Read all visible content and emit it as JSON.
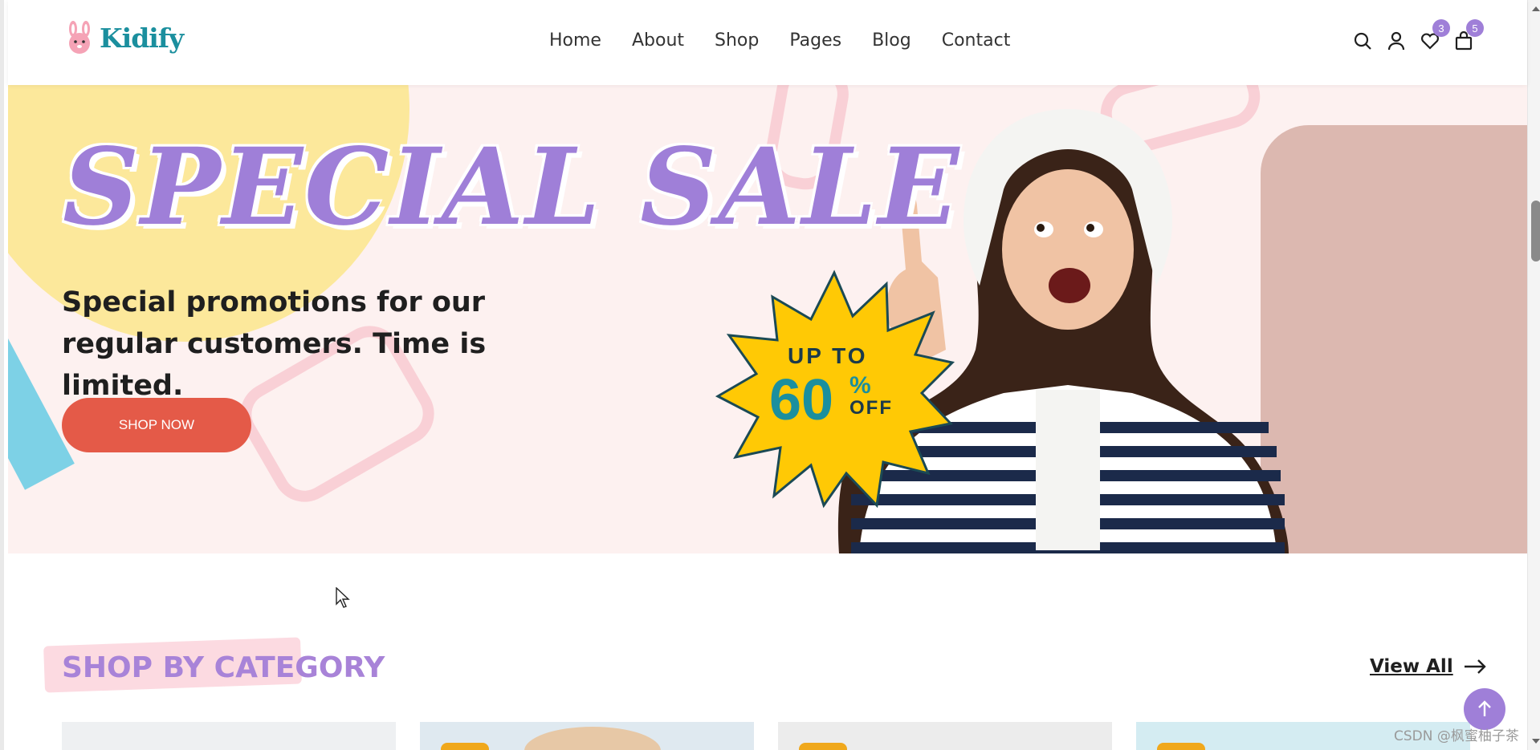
{
  "header": {
    "logo_text": "Kidify",
    "nav": [
      "Home",
      "About",
      "Shop",
      "Pages",
      "Blog",
      "Contact"
    ],
    "wishlist_count": "3",
    "cart_count": "5"
  },
  "hero": {
    "title": "SPECIAL SALE",
    "subtitle": "Special promotions for our regular customers. Time is limited.",
    "cta_label": "SHOP NOW",
    "badge_upto": "UP TO",
    "badge_number": "60",
    "badge_percent": "%",
    "badge_off": "OFF"
  },
  "category": {
    "title": "SHOP BY CATEGORY",
    "view_all": "View All"
  },
  "watermark": "CSDN @枫蜜柚子茶",
  "colors": {
    "accent": "#9f7fd8",
    "teal": "#1b8f9e",
    "cta": "#e45a48",
    "hero_bg": "#fdf1f0",
    "star": "#ffc905"
  },
  "icons": [
    "rabbit-logo-icon",
    "search-icon",
    "user-icon",
    "heart-icon",
    "bag-icon",
    "arrow-right-icon",
    "arrow-up-icon",
    "cursor-icon"
  ]
}
